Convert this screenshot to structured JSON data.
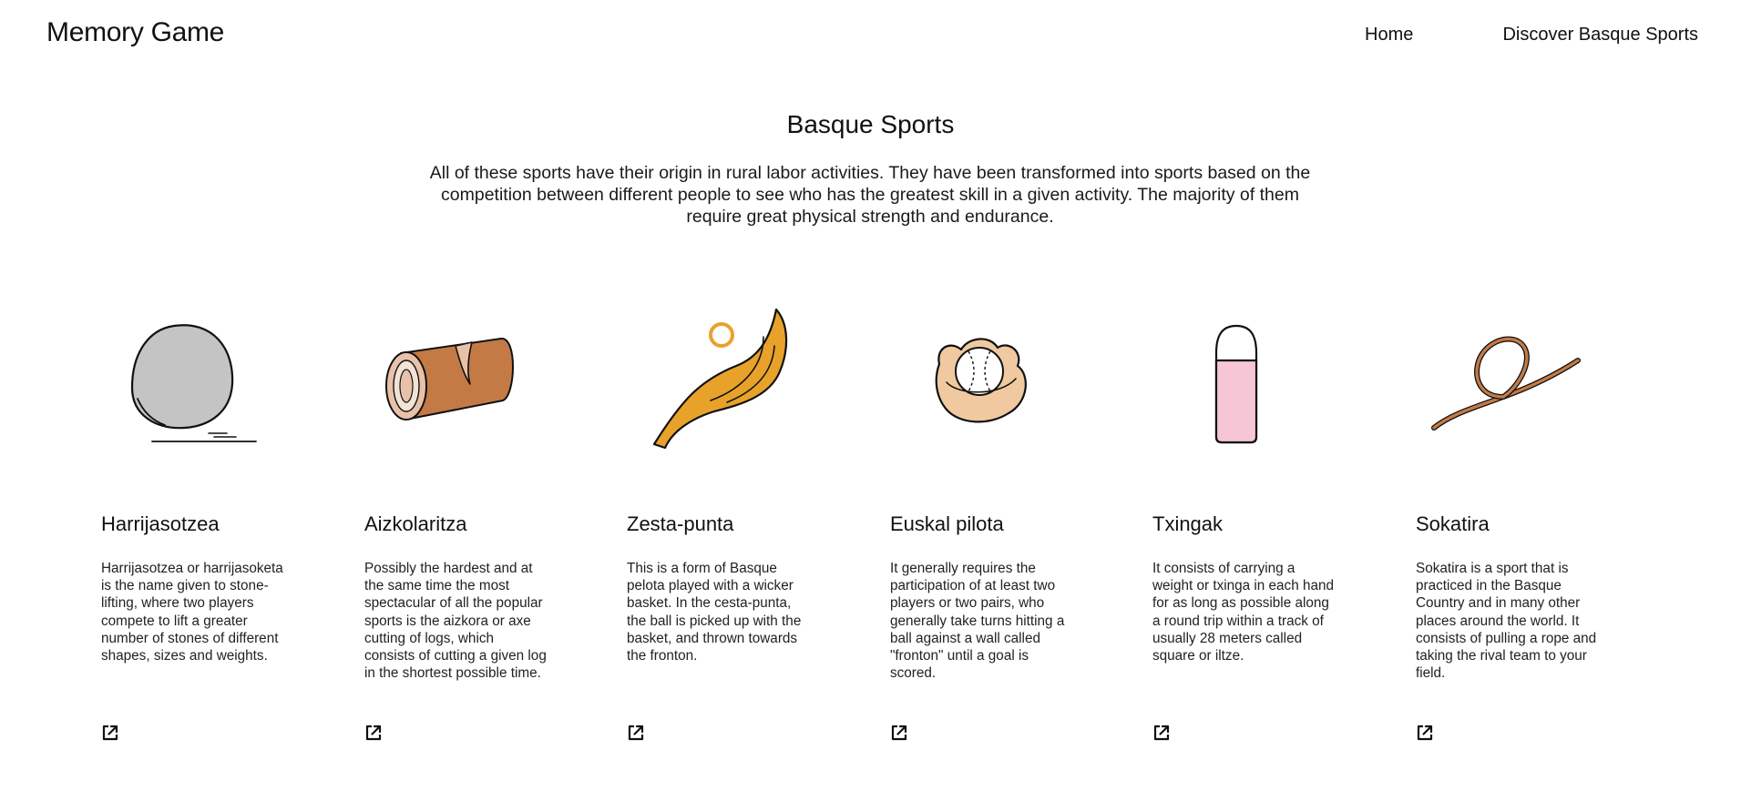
{
  "header": {
    "logo": "Memory Game",
    "nav": {
      "home": "Home",
      "discover": "Discover Basque Sports"
    }
  },
  "main": {
    "title": "Basque Sports",
    "intro": "All of these sports have their origin in rural labor activities. They have been transformed into sports based on the competition between different people to see who has the greatest skill in a given activity. The majority of them require great physical strength and endurance."
  },
  "sports": [
    {
      "name": "Harrijasotzea",
      "description": "Harrijasotzea or harrijasoketa is the name given to stone-lifting, where two players compete to lift a greater number of stones of different shapes, sizes and weights.",
      "icon": "stone-icon",
      "color": "#c4c4c4"
    },
    {
      "name": "Aizkolaritza",
      "description": "Possibly the hardest and at the same time the most spectacular of all the popular sports is the aizkora or axe cutting of logs, which consists of cutting a given log in the shortest possible time.",
      "icon": "log-icon",
      "color": "#c47a45"
    },
    {
      "name": "Zesta-punta",
      "description": "This is a form of Basque pelota played with a wicker basket. In the cesta-punta, the ball is picked up with the basket, and thrown towards the fronton.",
      "icon": "basket-icon",
      "color": "#e8a22a"
    },
    {
      "name": "Euskal pilota",
      "description": "It generally requires the participation of at least two players or two pairs, who generally take turns hitting a ball against a wall called \"fronton\" until a goal is scored.",
      "icon": "glove-ball-icon",
      "color": "#f0c9a0"
    },
    {
      "name": "Txingak",
      "description": "It consists of carrying a weight or txinga in each hand for as long as possible along a round trip within a track of usually 28 meters called square or iltze.",
      "icon": "weight-icon",
      "color": "#f7c6d6"
    },
    {
      "name": "Sokatira",
      "description": "Sokatira is a sport that is practiced in the Basque Country and in many other places around the world. It consists of pulling a rope and taking the rival team to your field.",
      "icon": "rope-icon",
      "color": "#c47a45"
    }
  ]
}
